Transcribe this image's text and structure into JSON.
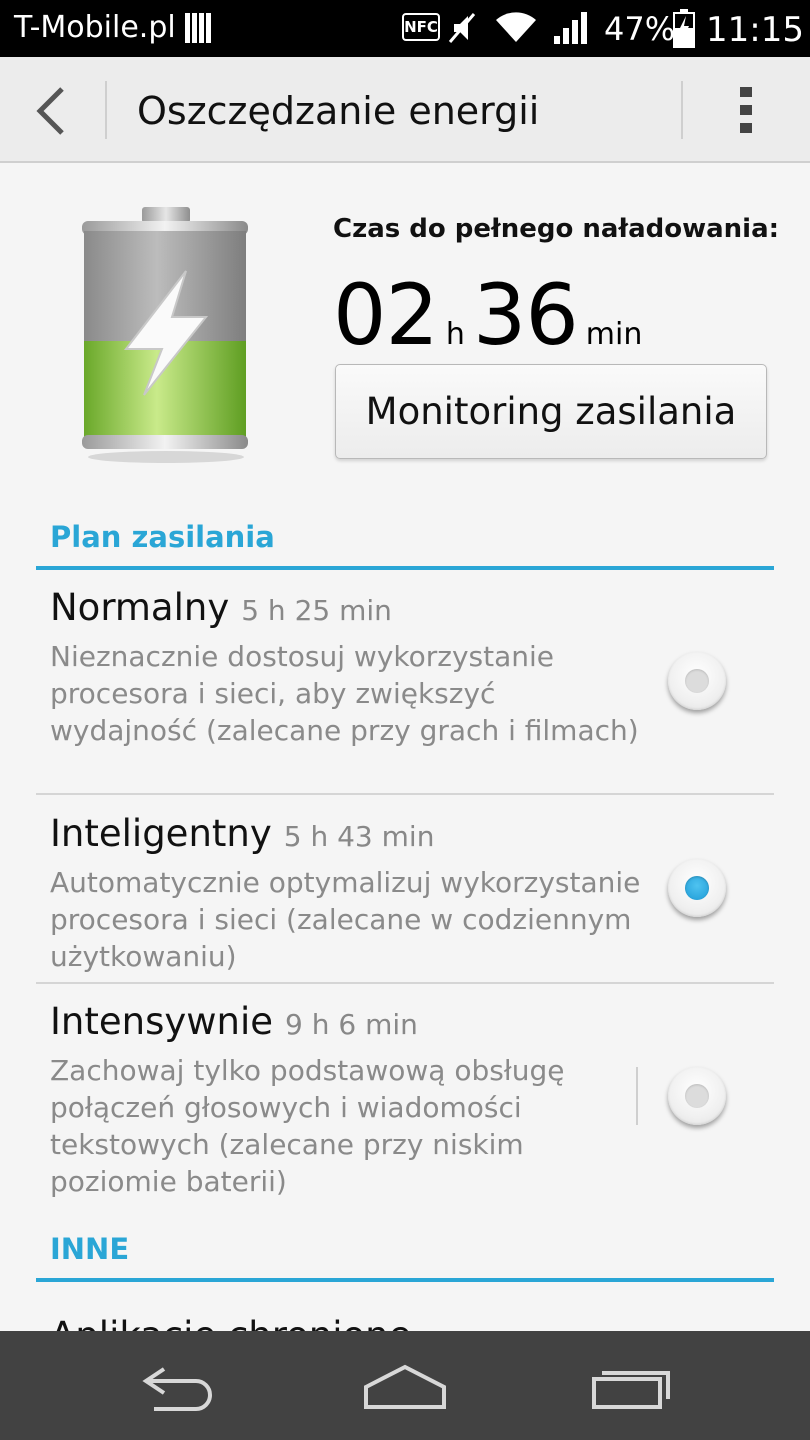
{
  "status_bar": {
    "carrier": "T-Mobile.pl",
    "nfc_label": "NFC",
    "battery_percent": "47%",
    "clock": "11:15",
    "icons": [
      "sim-icon",
      "nfc-icon",
      "mute-icon",
      "wifi-icon",
      "signal-icon",
      "battery-charging-icon"
    ]
  },
  "action_bar": {
    "title": "Oszczędzanie energii",
    "back_icon": "back-chevron-icon",
    "menu_icon": "overflow-menu-icon"
  },
  "charging": {
    "label": "Czas do pełnego naładowania:",
    "hours": "02",
    "hours_unit": "h",
    "minutes": "36",
    "minutes_unit": "min",
    "monitor_button": "Monitoring zasilania",
    "battery_level": 0.47
  },
  "power_plan": {
    "header": "Plan zasilania",
    "selected": "Inteligentny",
    "plans": [
      {
        "name": "Normalny",
        "time": "5 h 25 min",
        "description": "Nieznacznie dostosuj wykorzystanie procesora i sieci, aby zwiększyć wydajność (zalecane przy grach i filmach)",
        "checked": false
      },
      {
        "name": "Inteligentny",
        "time": "5 h 43 min",
        "description": "Automatycznie optymalizuj wykorzystanie procesora i sieci (zalecane w codziennym użytkowaniu)",
        "checked": true
      },
      {
        "name": "Intensywnie",
        "time": "9 h 6 min",
        "description": "Zachowaj tylko podstawową obsługę połączeń głosowych i wiadomości tekstowych (zalecane przy niskim poziomie baterii)",
        "checked": false
      }
    ]
  },
  "other": {
    "header": "INNE",
    "partial_item": "Aplikacje chronione"
  },
  "nav_bar": {
    "icons": [
      "back-icon",
      "home-icon",
      "recents-icon"
    ]
  },
  "colors": {
    "accent": "#2aa6d6",
    "status_bar": "#000000",
    "nav_bar": "#424242",
    "battery_fill": "#8cc63f"
  }
}
